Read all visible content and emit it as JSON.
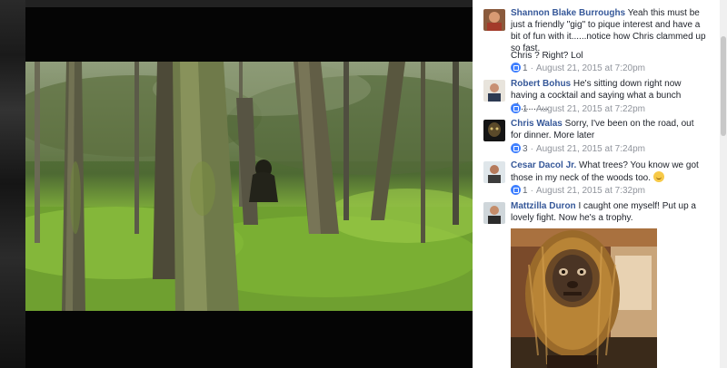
{
  "comments": [
    {
      "name": "Shannon Blake Burroughs",
      "text": "Yeah this must be just a friendly \"gig\" to pique interest and have a bit of fun with it......notice how Chris clammed up so fast.",
      "text2": "Chris ? Right? Lol",
      "likes": "1",
      "timestamp": "August 21, 2015 at 7:20pm"
    },
    {
      "name": "Robert Bohus",
      "text": "He's sitting down right now having a cocktail and saying what a bunch of............",
      "likes": "1",
      "timestamp": "August 21, 2015 at 7:22pm"
    },
    {
      "name": "Chris Walas",
      "text": "Sorry, I've been on the road, out for dinner. More later",
      "likes": "3",
      "timestamp": "August 21, 2015 at 7:24pm"
    },
    {
      "name": "Cesar Dacol Jr.",
      "text": "What trees? You know we got those in my neck of the woods too.",
      "likes": "1",
      "timestamp": "August 21, 2015 at 7:32pm"
    },
    {
      "name": "Mattzilla Duron",
      "text": "I caught one myself! Put up a lovely fight. Now he's a trophy."
    }
  ],
  "separator": "·",
  "icons": {
    "like": "like-thumb-icon",
    "emoji": "smiley-emoji-icon"
  },
  "colors": {
    "name": "#365899",
    "meta": "#90949c",
    "like_badge": "#4080ff"
  }
}
